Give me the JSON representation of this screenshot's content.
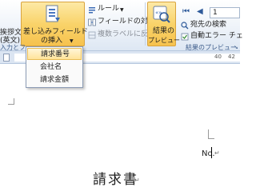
{
  "ribbon": {
    "greeting_btn": {
      "line1": "挨拶文",
      "line2": "(英文)"
    },
    "insert_field_btn": {
      "line1": "差し込みフィールド",
      "line2": "の挿入"
    },
    "rules_label": "ルール",
    "match_fields_label": "フィールドの対応",
    "update_labels_label": "複数ラベルに反映",
    "preview_btn": {
      "line1": "結果の",
      "line2": "プレビュー"
    },
    "record_number": "1",
    "find_recipient_label": "宛先の検索",
    "auto_error_label": "自動エラー チェ",
    "group_left_partial": "入力とフ",
    "group_preview_label": "結果のプレビュー"
  },
  "dropdown": {
    "items": [
      {
        "label": "請求番号",
        "highlighted": true
      },
      {
        "label": "会社名",
        "highlighted": false
      },
      {
        "label": "請求金額",
        "highlighted": false
      }
    ]
  },
  "document": {
    "number_label": "No.",
    "title": "請求書"
  },
  "colors": {
    "ribbon_bg": "#dde7f3",
    "highlight_button": "#f9d36a",
    "group_label": "#3d5c8a"
  }
}
